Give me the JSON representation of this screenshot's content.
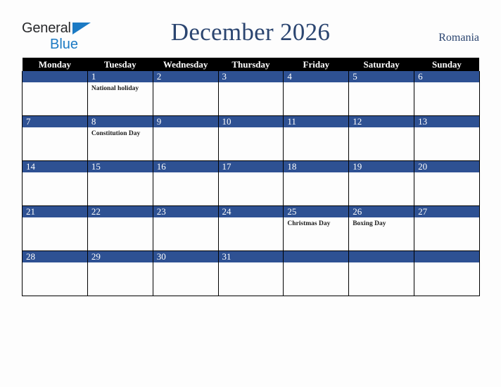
{
  "logo": {
    "word1": "General",
    "word2": "Blue",
    "triangle_color": "#1b7ac4",
    "word1_color": "#27282a",
    "word2_color": "#1b7ac4"
  },
  "header": {
    "title": "December 2026",
    "country": "Romania",
    "title_color": "#2b4570"
  },
  "calendar": {
    "weekday_headers": [
      "Monday",
      "Tuesday",
      "Wednesday",
      "Thursday",
      "Friday",
      "Saturday",
      "Sunday"
    ],
    "header_bg": "#000000",
    "daynum_bg": "#2e5193",
    "daynum_color": "#ffffff",
    "weeks": [
      [
        {
          "day": "",
          "events": []
        },
        {
          "day": "1",
          "events": [
            "National holiday"
          ]
        },
        {
          "day": "2",
          "events": []
        },
        {
          "day": "3",
          "events": []
        },
        {
          "day": "4",
          "events": []
        },
        {
          "day": "5",
          "events": []
        },
        {
          "day": "6",
          "events": []
        }
      ],
      [
        {
          "day": "7",
          "events": []
        },
        {
          "day": "8",
          "events": [
            "Constitution Day"
          ]
        },
        {
          "day": "9",
          "events": []
        },
        {
          "day": "10",
          "events": []
        },
        {
          "day": "11",
          "events": []
        },
        {
          "day": "12",
          "events": []
        },
        {
          "day": "13",
          "events": []
        }
      ],
      [
        {
          "day": "14",
          "events": []
        },
        {
          "day": "15",
          "events": []
        },
        {
          "day": "16",
          "events": []
        },
        {
          "day": "17",
          "events": []
        },
        {
          "day": "18",
          "events": []
        },
        {
          "day": "19",
          "events": []
        },
        {
          "day": "20",
          "events": []
        }
      ],
      [
        {
          "day": "21",
          "events": []
        },
        {
          "day": "22",
          "events": []
        },
        {
          "day": "23",
          "events": []
        },
        {
          "day": "24",
          "events": []
        },
        {
          "day": "25",
          "events": [
            "Christmas Day"
          ]
        },
        {
          "day": "26",
          "events": [
            "Boxing Day"
          ]
        },
        {
          "day": "27",
          "events": []
        }
      ],
      [
        {
          "day": "28",
          "events": []
        },
        {
          "day": "29",
          "events": []
        },
        {
          "day": "30",
          "events": []
        },
        {
          "day": "31",
          "events": []
        },
        {
          "day": "",
          "events": []
        },
        {
          "day": "",
          "events": []
        },
        {
          "day": "",
          "events": []
        }
      ]
    ]
  }
}
